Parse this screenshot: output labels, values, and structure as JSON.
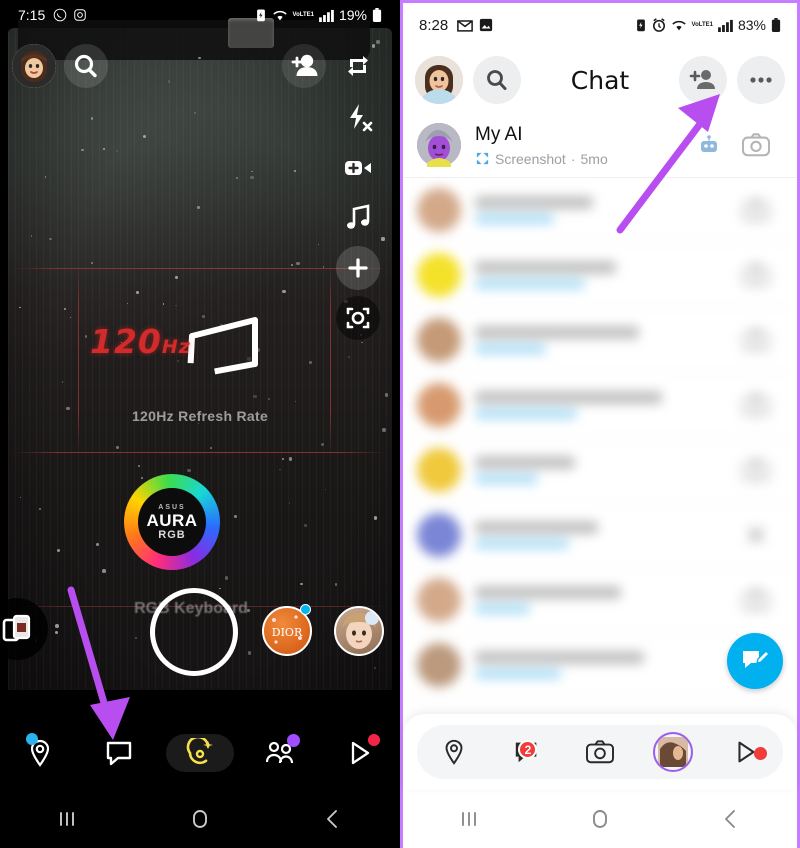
{
  "left_phone": {
    "status_bar": {
      "time": "7:15",
      "left_icons": [
        "whatsapp-icon",
        "instagram-icon"
      ],
      "battery_text": "19%",
      "right_icons": [
        "battery-saver-icon",
        "wifi-icon",
        "volte-lte-icon",
        "signal-icon",
        "battery-icon"
      ],
      "network_label": "VoLTE1"
    },
    "camera": {
      "avatar": "bitmoji-avatar",
      "search_icon": "search-icon",
      "add_friend_icon": "add-friend-icon",
      "flip_camera_icon": "flip-camera-icon",
      "rail": [
        {
          "name": "flash-off-icon"
        },
        {
          "name": "add-video-icon"
        },
        {
          "name": "music-icon"
        },
        {
          "name": "plus-icon"
        },
        {
          "name": "scan-icon"
        }
      ],
      "overlay": {
        "hz_value": "120",
        "hz_unit": "Hz",
        "caption": "120Hz Refresh Rate",
        "aura_brand": "ASUS",
        "aura_title": "AURA",
        "aura_sub": "RGB",
        "keyboard_label": "RGB Keyboard"
      },
      "memories_icon": "memories-icon",
      "shutter_button": "shutter-button",
      "lenses": [
        {
          "name": "lens-dior",
          "label": "DIOR"
        },
        {
          "name": "lens-character",
          "label": ""
        }
      ]
    },
    "bottom_nav": [
      {
        "name": "map-tab",
        "icon": "map-pin-icon",
        "badge_color": ""
      },
      {
        "name": "chat-tab",
        "icon": "chat-icon",
        "badge_color": "#2bb3ef"
      },
      {
        "name": "camera-tab",
        "icon": "snap-camera-icon",
        "badge_color": ""
      },
      {
        "name": "friends-tab",
        "icon": "friends-icon",
        "badge_color": "#a24dff"
      },
      {
        "name": "spotlight-tab",
        "icon": "play-icon",
        "badge_color": "#f5254a"
      }
    ],
    "system_nav": [
      {
        "name": "recents-button",
        "glyph": "|||"
      },
      {
        "name": "home-button",
        "glyph": "O"
      },
      {
        "name": "back-button",
        "glyph": "<"
      }
    ]
  },
  "right_phone": {
    "status_bar": {
      "time": "8:28",
      "left_icons": [
        "gmail-icon",
        "gallery-icon"
      ],
      "battery_text": "83%",
      "right_icons": [
        "battery-saver-icon",
        "alarm-icon",
        "wifi-icon",
        "volte-lte-icon",
        "signal-icon",
        "battery-icon"
      ],
      "network_label": "VoLTE1"
    },
    "header": {
      "avatar": "profile-avatar",
      "search_icon": "search-icon",
      "title": "Chat",
      "add_friend_icon": "add-friend-icon",
      "more_icon": "more-options-icon"
    },
    "chat_rows": [
      {
        "name": "My AI",
        "status": "Screenshot",
        "time": "5mo",
        "status_icon": "screenshot-icon",
        "avatar_color": "#b06ad6",
        "action": "camera-icon",
        "blurred": false,
        "extra_icon": "robot-emoji"
      },
      {
        "name": "",
        "status": "",
        "time": "",
        "avatar_color": "#d3a98a",
        "action": "camera-icon",
        "blurred": true
      },
      {
        "name": "",
        "status": "",
        "time": "",
        "avatar_color": "#f4e12a",
        "action": "camera-icon",
        "blurred": true
      },
      {
        "name": "",
        "status": "",
        "time": "",
        "avatar_color": "#c49a77",
        "action": "camera-icon",
        "blurred": true
      },
      {
        "name": "",
        "status": "",
        "time": "",
        "avatar_color": "#d79a6e",
        "action": "camera-icon",
        "blurred": true
      },
      {
        "name": "",
        "status": "",
        "time": "",
        "avatar_color": "#f0c93c",
        "action": "camera-icon",
        "blurred": true
      },
      {
        "name": "",
        "status": "",
        "time": "",
        "avatar_color": "#7b86d6",
        "action": "close-icon",
        "blurred": true
      },
      {
        "name": "",
        "status": "",
        "time": "",
        "avatar_color": "#d3a98a",
        "action": "camera-icon",
        "blurred": true
      },
      {
        "name": "",
        "status": "",
        "time": "",
        "avatar_color": "#bb9a7e",
        "action": "camera-icon",
        "blurred": true
      }
    ],
    "compose_fab": {
      "name": "new-chat-fab",
      "icon": "compose-chat-icon",
      "color": "#00b0ef"
    },
    "bottom_nav": [
      {
        "name": "map-tab",
        "icon": "map-pin-icon",
        "badge": ""
      },
      {
        "name": "chat-tab",
        "icon": "chat-filled-icon",
        "badge": "2"
      },
      {
        "name": "camera-tab",
        "icon": "camera-icon",
        "badge": ""
      },
      {
        "name": "stories-tab",
        "icon": "story-avatar",
        "badge": ""
      },
      {
        "name": "spotlight-tab",
        "icon": "play-icon",
        "badge": "dot"
      }
    ],
    "system_nav": [
      {
        "name": "recents-button",
        "glyph": "|||"
      },
      {
        "name": "home-button",
        "glyph": "O"
      },
      {
        "name": "back-button",
        "glyph": "<"
      }
    ]
  },
  "annotations": [
    {
      "name": "arrow-to-chat-tab",
      "color": "#b84df0"
    },
    {
      "name": "arrow-to-add-friend",
      "color": "#b84df0"
    }
  ]
}
